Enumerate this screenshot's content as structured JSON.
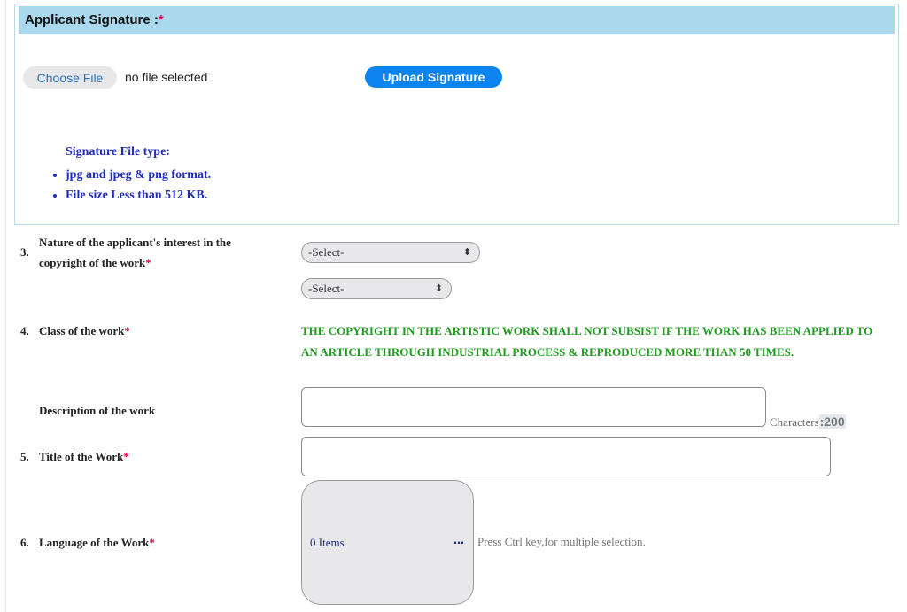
{
  "signature": {
    "header_label": "Applicant Signature :",
    "required_mark": "*",
    "choose_file_label": "Choose File",
    "file_status": "no file selected",
    "upload_label": "Upload Signature",
    "note_title": "Signature File type:",
    "note_items": [
      "jpg and jpeg & png format.",
      "File size Less than 512 KB."
    ]
  },
  "rows": {
    "interest": {
      "number": "3.",
      "label_line1": "Nature of the applicant's interest in the",
      "label_line2": "copyright of the work",
      "required_mark": "*",
      "select1_value": "-Select-",
      "select2_value": "-Select-"
    },
    "class": {
      "number": "4.",
      "label": "Class of the work",
      "required_mark": "*",
      "notice": "THE COPYRIGHT IN THE ARTISTIC WORK SHALL NOT SUBSIST IF THE WORK HAS BEEN APPLIED TO AN ARTICLE THROUGH INDUSTRIAL PROCESS & REPRODUCED MORE THAN 50 TIMES."
    },
    "description": {
      "label": "Description of the work",
      "value": "",
      "counter_label": "Characters",
      "counter_sep": ":",
      "counter_value": "200"
    },
    "title": {
      "number": "5.",
      "label": "Title of the Work",
      "required_mark": "*",
      "value": ""
    },
    "language": {
      "number": "6.",
      "label": "Language of the Work",
      "required_mark": "*",
      "items_label": "0 Items",
      "dots": "…",
      "hint": "Press Ctrl key,for multiple selection."
    }
  }
}
